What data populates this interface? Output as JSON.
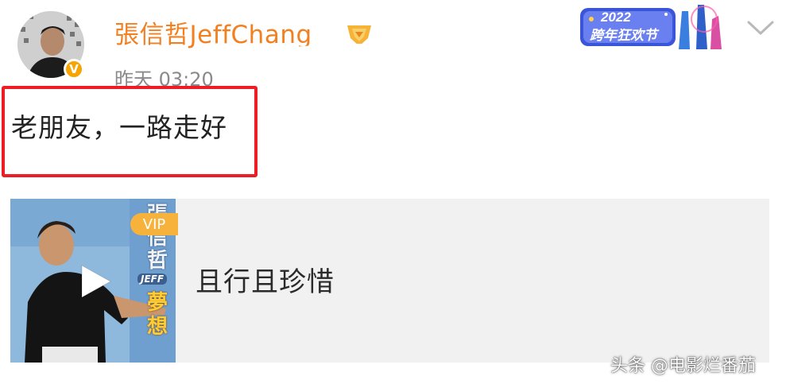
{
  "user": {
    "name": "張信哲JeffChang",
    "verified_badge": "V",
    "timestamp": "昨天 03:20",
    "avatar_icon": "user-avatar-photo",
    "medal_icon": "user-level-medal-icon"
  },
  "banner": {
    "year": "2022",
    "title": "跨年狂欢节"
  },
  "post": {
    "text": "老朋友，一路走好",
    "highlight_color": "#ee1c25"
  },
  "music_card": {
    "song_title": "且行且珍惜",
    "vip_label": "VIP",
    "cover_text_vertical": "張信哲",
    "cover_jeff": "JEFF",
    "cover_dream": "夢想",
    "play_icon": "play-icon"
  },
  "watermark": "头条 @电影烂番茄",
  "colors": {
    "username": "#f28020",
    "timestamp": "#8a8a8a",
    "card_bg": "#f1f1f1",
    "vip": "#f7b23b"
  }
}
